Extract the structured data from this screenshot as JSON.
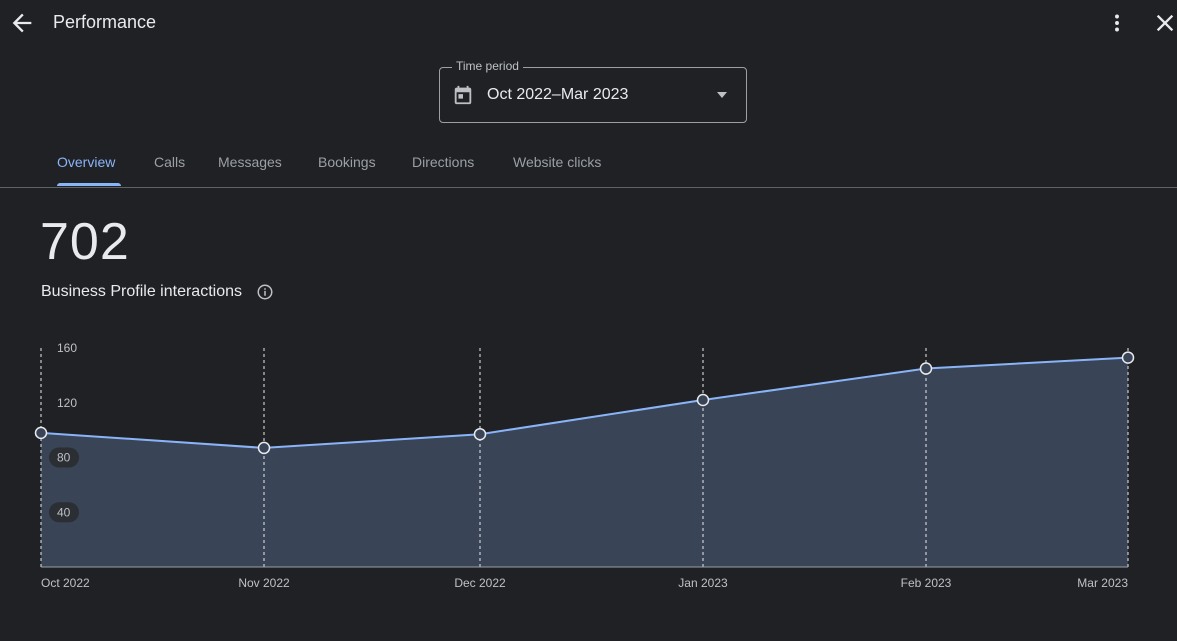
{
  "header": {
    "title": "Performance",
    "back_icon": "arrow-back-icon",
    "more_icon": "more-vert-icon",
    "close_icon": "close-icon"
  },
  "time_period": {
    "label": "Time period",
    "value": "Oct 2022–Mar 2023",
    "icon": "calendar-icon"
  },
  "tabs": [
    {
      "label": "Overview",
      "active": true
    },
    {
      "label": "Calls",
      "active": false
    },
    {
      "label": "Messages",
      "active": false
    },
    {
      "label": "Bookings",
      "active": false
    },
    {
      "label": "Directions",
      "active": false
    },
    {
      "label": "Website clicks",
      "active": false
    }
  ],
  "metric": {
    "value": "702",
    "label": "Business Profile interactions"
  },
  "colors": {
    "background": "#202124",
    "accent": "#8ab4f8",
    "area_fill": "#394457"
  },
  "chart_data": {
    "type": "area",
    "x": [
      "Oct 2022",
      "Nov 2022",
      "Dec 2022",
      "Jan 2023",
      "Feb 2023",
      "Mar 2023"
    ],
    "values": [
      98,
      87,
      97,
      122,
      145,
      153
    ],
    "yticks": [
      40,
      80,
      120,
      160
    ],
    "ylim": [
      0,
      160
    ],
    "grid": "vertical-dashed"
  }
}
